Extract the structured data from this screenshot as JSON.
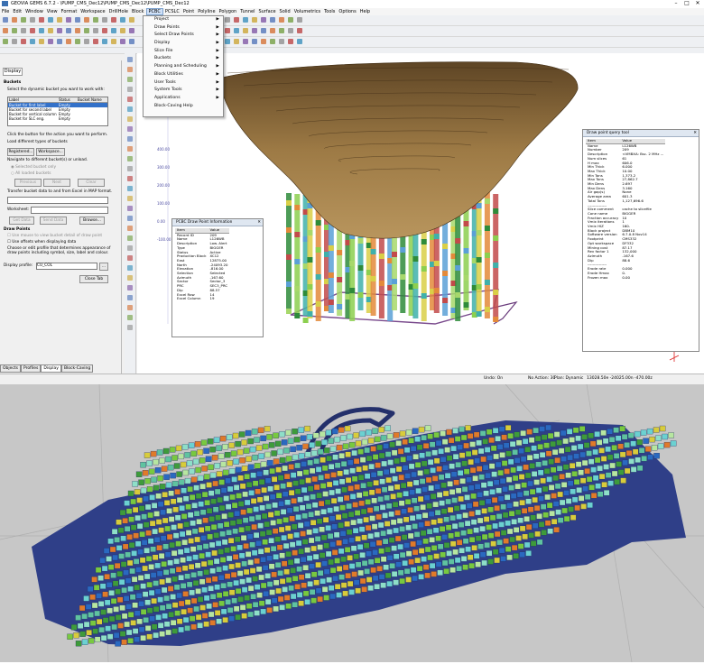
{
  "app": {
    "title": "GEOVIA GEMS 6.7.2 - \\PUMP_CMS_Dec12\\PUMP_CMS_Dec12\\PUMP_CMS_Dec12",
    "controls": [
      "–",
      "□",
      "✕"
    ]
  },
  "menubar": [
    "File",
    "Edit",
    "Window",
    "View",
    "Format",
    "Workspace",
    "DrillHole",
    "Block",
    "PCBC",
    "PCSLC",
    "Point",
    "Polyline",
    "Polygon",
    "Tunnel",
    "Surface",
    "Solid",
    "Volumetrics",
    "Tools",
    "Options",
    "Help"
  ],
  "menubar_active": "PCBC",
  "pcbc_menu": [
    {
      "label": "Project",
      "submenu": true
    },
    {
      "label": "Draw Points",
      "submenu": true
    },
    {
      "label": "Select Draw Points",
      "submenu": true
    },
    {
      "label": "Display",
      "submenu": true
    },
    {
      "label": "Slice File",
      "submenu": true
    },
    {
      "label": "Buckets",
      "submenu": true
    },
    {
      "label": "Planning and Scheduling",
      "submenu": true
    },
    {
      "label": "Block Utilities",
      "submenu": true
    },
    {
      "label": "User Tools",
      "submenu": true
    },
    {
      "label": "System Tools",
      "submenu": true
    },
    {
      "label": "Applications",
      "submenu": true
    },
    {
      "label": "Block-Caving Help",
      "submenu": false
    }
  ],
  "panel": {
    "tab": "Display",
    "buckets_heading": "Buckets",
    "select_prompt": "Select the dynamic bucket you want to work with:",
    "columns": [
      "Label",
      "Status",
      "Bucket Name"
    ],
    "rows": [
      {
        "label": "Bucket for first label",
        "status": "Empty",
        "name": ""
      },
      {
        "label": "Bucket for second label",
        "status": "Empty",
        "name": ""
      },
      {
        "label": "Bucket for vertical column",
        "status": "Empty",
        "name": ""
      },
      {
        "label": "Bucket for SLC eng.",
        "status": "Empty",
        "name": ""
      }
    ],
    "click_prompt": "Click the button for the action you want to perform.",
    "load_prompt": "Load different types of buckets",
    "registered_label": "Registered...",
    "workspace_label": "Workspace...",
    "navigate_prompt": "Navigate to different bucket(s) or unload.",
    "radio_selected": "Selected bucket only",
    "radio_all": "All loaded buckets",
    "previous_label": "Previous",
    "next_label": "Next",
    "clear_label": "Clear",
    "transfer_prompt": "Transfer bucket data to and from Excel in MAP format.",
    "worksheet_label": "Worksheet:",
    "worksheet_value": "",
    "get_data_label": "Get Data",
    "send_data_label": "Send Data",
    "browse_label": "Browse...",
    "draw_points_heading": "Draw Points",
    "use_mouse_label": "Use mouse to view bucket detail of draw point",
    "use_offsets_label": "Use offsets when displaying data",
    "profile_prompt": "Choose or edit profile that determines appearance of draw points including symbol, size, label and colour.",
    "display_profile_label": "Display profile:",
    "display_profile_value": "CU_COL",
    "profile_button_label": "...",
    "close_tab_label": "Close Tab",
    "bottom_tabs": [
      "Objects",
      "Profiles",
      "Display",
      "Block-Caving"
    ],
    "bottom_tab_active": "Display"
  },
  "status": {
    "undo": "Undo: On",
    "action": "No Action: 30",
    "plan": "Plan: Dynamic",
    "coords": "13028.50e  -24025.00n  -470.00z"
  },
  "axis_labels": [
    "400.00",
    "300.00",
    "200.00",
    "100.00",
    "0.00",
    "-100.00"
  ],
  "draw_point_info": {
    "title": "PCBC Draw Point Information",
    "columns": [
      "Item",
      "Value"
    ],
    "rows": [
      [
        "Record ID",
        "209"
      ],
      [
        "Name",
        "L126WB"
      ],
      [
        "Description",
        "Low. Alert"
      ],
      [
        "Type",
        "BIGGER"
      ],
      [
        "Status",
        "Active"
      ],
      [
        "Production Block",
        "XC12"
      ],
      [
        "East",
        "12875.00"
      ],
      [
        "North",
        "-24093.20"
      ],
      [
        "Elevation",
        "-816.00"
      ],
      [
        "Selection",
        "Selected"
      ],
      [
        "Azimuth",
        "-167.60"
      ],
      [
        "Sector",
        "Sector_3"
      ],
      [
        "PRC",
        "SEC3_PRC"
      ],
      [
        "Dip",
        "88.57"
      ],
      [
        "Excel Row",
        "14"
      ],
      [
        "Excel Column",
        "19"
      ]
    ]
  },
  "query_tool": {
    "title": "Draw point query tool",
    "columns": [
      "Item",
      "Value"
    ],
    "rows": [
      [
        "Name",
        "L126WB"
      ],
      [
        "Number",
        "209"
      ],
      [
        "Description",
        "<VMBXA: Bsc. 2 MHz ..."
      ],
      [
        "Num slices",
        "61"
      ],
      [
        "H max",
        "606.0"
      ],
      [
        "Min Thick",
        "6.000"
      ],
      [
        "Max Thick",
        "10.00"
      ],
      [
        "Min Tons",
        "1,373.2"
      ],
      [
        "Max Tons",
        "27,862.7"
      ],
      [
        "Min Dens",
        "2.697"
      ],
      [
        "Max Dens",
        "3.160"
      ],
      [
        "Air gap(s)",
        "None"
      ],
      [
        "Average area",
        "601.3"
      ],
      [
        "Total Tons",
        "1,127,696.6"
      ],
      [
        "---------------",
        ""
      ],
      [
        "Slice comment",
        "cache to slicefile"
      ],
      [
        "Cone name",
        "BIGGER"
      ],
      [
        "Fraction accuracy",
        "10"
      ],
      [
        "Vmix iterations",
        "1"
      ],
      [
        "Vmix HIZ",
        "160."
      ],
      [
        "Block project",
        "DBM10"
      ],
      [
        "Software version",
        "6.7.0.8 Nov14"
      ],
      [
        "Footprint",
        "CMS332"
      ],
      [
        "Opt workspace",
        "DF332"
      ],
      [
        "Mining cost",
        "87.17"
      ],
      [
        "Rev factor 1",
        "132,000"
      ],
      [
        "Azimuth",
        "-167.6"
      ],
      [
        "Dip",
        "88.6"
      ],
      [
        "---------------",
        ""
      ],
      [
        "Erode rate",
        "0.000"
      ],
      [
        "Erode Hmax",
        "0."
      ],
      [
        "Frozen max",
        "0.00"
      ]
    ]
  }
}
